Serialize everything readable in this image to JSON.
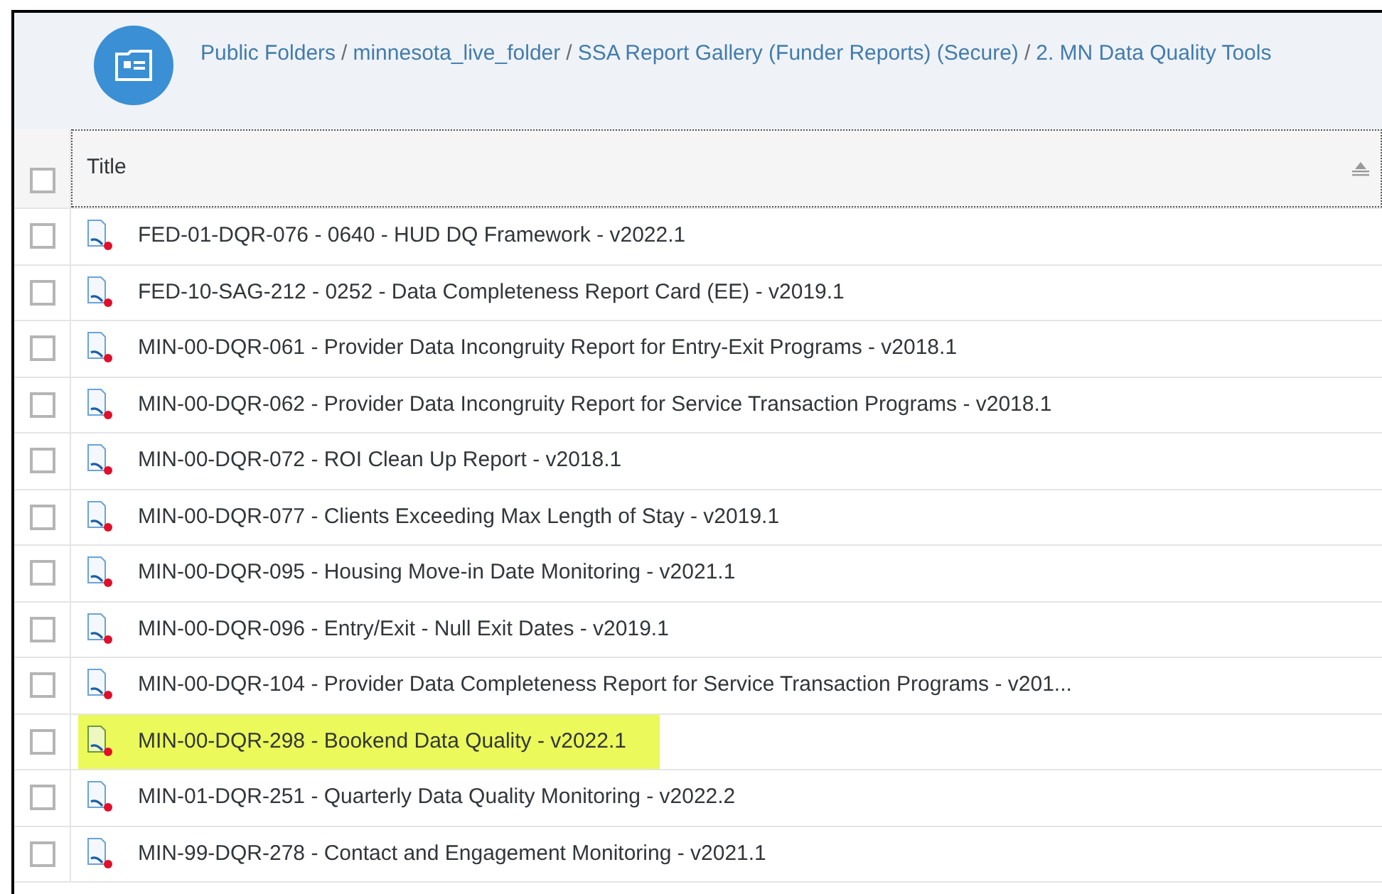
{
  "breadcrumb": [
    "Public Folders",
    "minnesota_live_folder",
    "SSA Report Gallery (Funder Reports) (Secure)",
    "2. MN Data Quality Tools"
  ],
  "breadcrumb_separator": "/",
  "table": {
    "select_all": {
      "checked": false
    },
    "columns": [
      {
        "label": "Title"
      }
    ],
    "rows": [
      {
        "title": "FED-01-DQR-076 - 0640 - HUD DQ Framework - v2022.1",
        "checked": false,
        "highlighted": false
      },
      {
        "title": "FED-10-SAG-212 - 0252 - Data Completeness Report Card (EE) - v2019.1",
        "checked": false,
        "highlighted": false
      },
      {
        "title": "MIN-00-DQR-061 - Provider Data Incongruity Report for Entry-Exit Programs - v2018.1",
        "checked": false,
        "highlighted": false
      },
      {
        "title": "MIN-00-DQR-062 - Provider Data Incongruity Report for Service Transaction Programs - v2018.1",
        "checked": false,
        "highlighted": false
      },
      {
        "title": "MIN-00-DQR-072 - ROI Clean Up Report - v2018.1",
        "checked": false,
        "highlighted": false
      },
      {
        "title": "MIN-00-DQR-077 - Clients Exceeding Max Length of Stay - v2019.1",
        "checked": false,
        "highlighted": false
      },
      {
        "title": "MIN-00-DQR-095 - Housing Move-in Date Monitoring - v2021.1",
        "checked": false,
        "highlighted": false
      },
      {
        "title": "MIN-00-DQR-096 - Entry/Exit - Null Exit Dates - v2019.1",
        "checked": false,
        "highlighted": false
      },
      {
        "title": "MIN-00-DQR-104 - Provider Data Completeness Report for Service Transaction Programs - v201...",
        "checked": false,
        "highlighted": false
      },
      {
        "title": "MIN-00-DQR-298 - Bookend Data Quality - v2022.1",
        "checked": false,
        "highlighted": true
      },
      {
        "title": "MIN-01-DQR-251 - Quarterly Data Quality Monitoring - v2022.2",
        "checked": false,
        "highlighted": false
      },
      {
        "title": "MIN-99-DQR-278 - Contact and Engagement Monitoring - v2021.1",
        "checked": false,
        "highlighted": false
      }
    ]
  }
}
